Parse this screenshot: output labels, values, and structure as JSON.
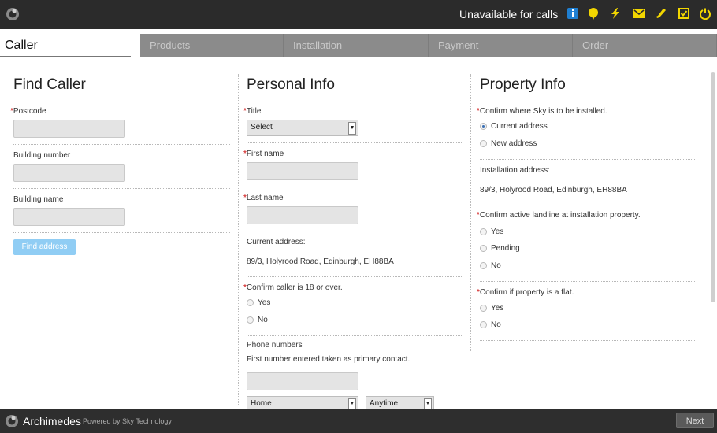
{
  "topbar": {
    "status": "Unavailable for calls",
    "icons": [
      "info-icon",
      "chat-bubble-icon",
      "lightning-icon",
      "mail-icon",
      "phone-icon",
      "checkbox-icon",
      "power-icon"
    ],
    "icon_color": "#f2d600",
    "info_color": "#1f7fd1"
  },
  "tabs": [
    "Caller",
    "Products",
    "Installation",
    "Payment",
    "Order"
  ],
  "find_caller": {
    "title": "Find Caller",
    "postcode_label": "Postcode",
    "building_number_label": "Building number",
    "building_name_label": "Building name",
    "find_button": "Find address"
  },
  "personal_info": {
    "title": "Personal Info",
    "title_label": "Title",
    "title_select": "Select",
    "first_name_label": "First name",
    "last_name_label": "Last name",
    "current_address_label": "Current address:",
    "current_address_value": "89/3, Holyrood Road, Edinburgh, EH88BA",
    "age_question": "Confirm caller is 18 or over.",
    "age_options": [
      "Yes",
      "No"
    ],
    "phone_label": "Phone numbers",
    "phone_hint": "First number entered taken as primary contact.",
    "phone_type": "Home",
    "phone_time": "Anytime"
  },
  "property_info": {
    "title": "Property Info",
    "where_question": "Confirm where Sky is to be installed.",
    "where_options": [
      "Current address",
      "New address"
    ],
    "where_selected": "Current address",
    "install_address_label": "Installation address:",
    "install_address_value": "89/3, Holyrood Road, Edinburgh, EH88BA",
    "landline_question": "Confirm active landline at installation property.",
    "landline_options": [
      "Yes",
      "Pending",
      "No"
    ],
    "flat_question": "Confirm if property is a flat.",
    "flat_options": [
      "Yes",
      "No"
    ]
  },
  "footer": {
    "brand": "Archimedes",
    "powered_by": "Powered by Sky Technology",
    "next_button": "Next"
  }
}
